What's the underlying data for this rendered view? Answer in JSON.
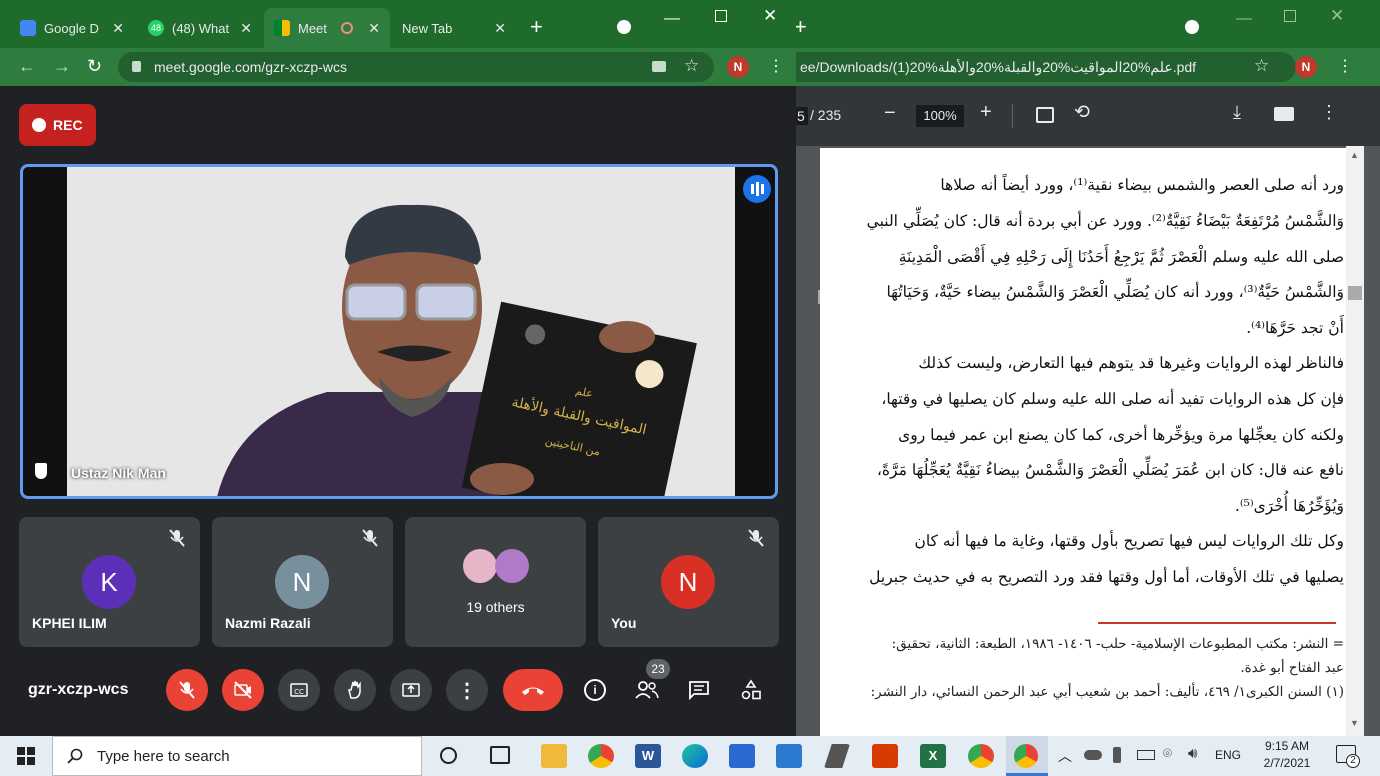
{
  "left_browser": {
    "tabs": [
      {
        "label": "Google D",
        "fav_color": "#4285f4"
      },
      {
        "label": "(48) What",
        "fav_color": "#25d366"
      },
      {
        "label": "Meet",
        "fav_color": "#00832d"
      },
      {
        "label": "New Tab",
        "fav_color": ""
      }
    ],
    "url": "meet.google.com/gzr-xczp-wcs",
    "profile": "N"
  },
  "meet": {
    "rec_label": "REC",
    "main_speaker": "Ustaz Nik Man",
    "book_text": {
      "line1": "علم",
      "line2": "المواقيت والقبلة والأهلة",
      "line3": "من الناحيتين"
    },
    "tiles": [
      {
        "initial": "K",
        "name": "KPHEI ILIM",
        "color": "#5b2fb8"
      },
      {
        "initial": "N",
        "name": "Nazmi Razali",
        "color": "#78909c"
      },
      {
        "initial": "",
        "name": "19 others",
        "color": ""
      },
      {
        "initial": "N",
        "name": "You",
        "color": "#d93025"
      }
    ],
    "meeting_code": "gzr-xczp-wcs",
    "people_count": "23"
  },
  "right_browser": {
    "url": "ee/Downloads/(1)20%علم%20المواقيت%20والقبلة%20والأهلة.pdf",
    "profile": "N",
    "page_total": "/ 235",
    "page_current": "5",
    "zoom": "100%"
  },
  "pdf": {
    "p1": [
      "ورد أنه صلى العصر والشمس بيضاء نقية⁽¹⁾، وورد أيضاً أنه صلاها",
      "وَالشَّمْسُ مُرْتَفِعَةٌ بَيْضَاءُ نَقِيَّةٌ⁽²⁾. وورد عن أبي بردة أنه قال: كان يُصَلِّي النبي",
      "صلى الله عليه وسلم الْعَصْرَ ثُمَّ يَرْجِعُ أَحَدُنَا إِلَى رَحْلِهِ فِي أَقْصَى الْمَدِينَةِ",
      "وَالشَّمْسُ حَيَّةٌ⁽³⁾، وورد أنه كان يُصَلِّي الْعَصْرَ وَالشَّمْسُ بيضاء حَيَّةٌ، وَحَيَاتُهَا",
      "أَنْ تجد حَرَّهَا⁽⁴⁾."
    ],
    "p2": [
      "فالناظر لهذه الروايات وغيرها قد يتوهم فيها التعارض، وليست كذلك",
      "فإن كل هذه الروايات تفيد أنه صلى الله عليه وسلم كان يصليها في وقتها،",
      "ولكنه كان يعجِّلها مرة ويؤخِّرها أخرى، كما كان يصنع ابن عمر فيما روى",
      "نافع عنه قال: كان ابن عُمَرَ يُصَلِّي الْعَصْرَ وَالشَّمْسُ بيضاءُ نَقِيَّةٌ يُعَجِّلُهَا مَرَّةً،",
      "وَيُؤَخِّرُهَا أُخْرَى⁽⁵⁾."
    ],
    "p3": [
      "وكل تلك الروايات ليس فيها تصريح بأول وقتها، وغاية ما فيها أنه كان",
      "يصليها في تلك الأوقات، أما أول وقتها فقد ورد التصريح به في حديث جبريل"
    ],
    "footnotes": [
      "= النشر: مكتب المطبوعات الإسلامية- حلب- ١٤٠٦- ١٩٨٦، الطبعة: الثانية، تحقيق:",
      "عبد الفتاح أبو غدة.",
      "(١) السنن الكبرى١/ ٤٦٩، تأليف: أحمد بن شعيب أبي عبد الرحمن النسائي، دار النشر:"
    ]
  },
  "taskbar": {
    "search_placeholder": "Type here to search",
    "time": "9:15 AM",
    "date": "2/7/2021",
    "lang": "ENG",
    "notif": "2"
  }
}
